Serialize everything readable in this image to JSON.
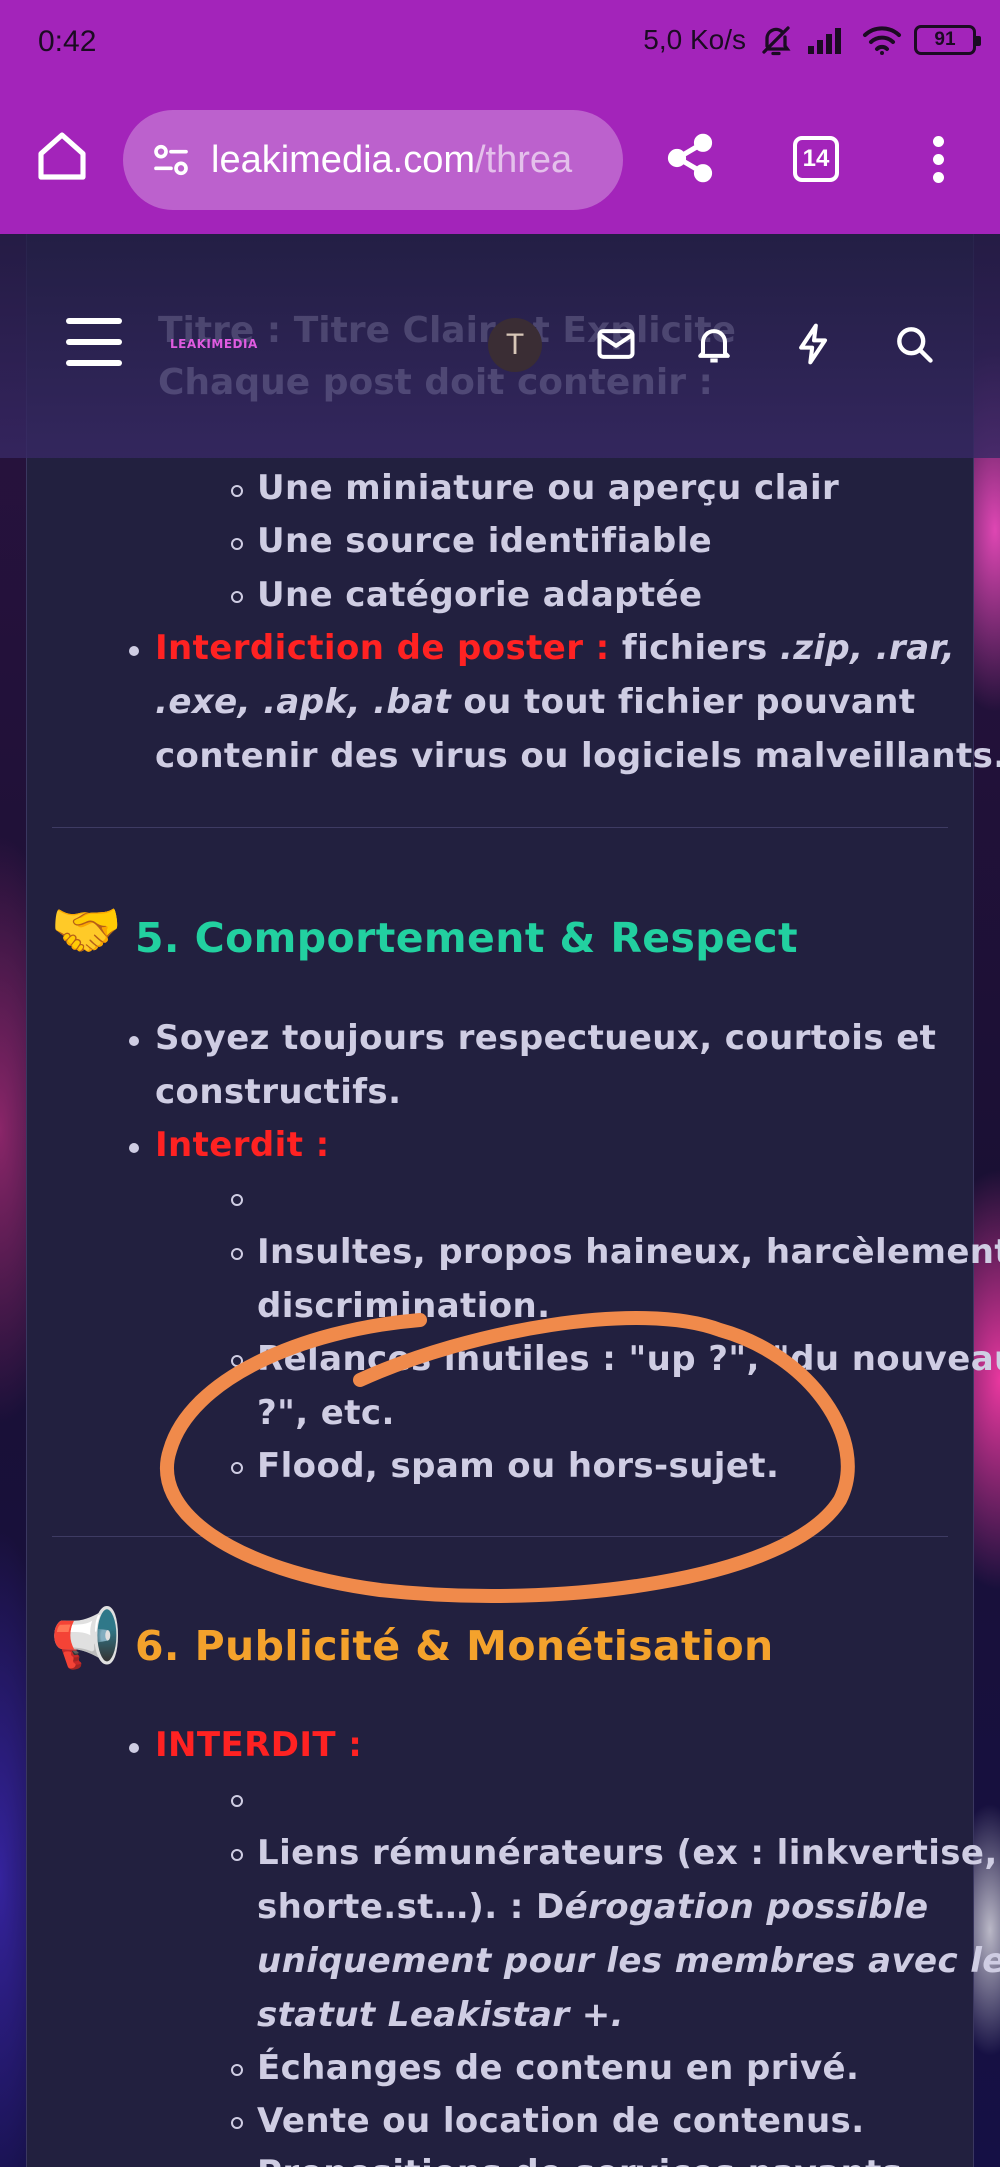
{
  "status_bar": {
    "time": "0:42",
    "speed": "5,0 Ko/s",
    "battery": "91"
  },
  "browser": {
    "url_domain": "leakimedia.com",
    "url_path": "/threa",
    "tab_count": "14"
  },
  "site_header": {
    "logo_text": "LEAKIMEDIA",
    "avatar_letter": "T",
    "ghost_line_1": "Titre : Titre Clair et Explicite",
    "ghost_line_2": "Chaque post doit contenir :"
  },
  "article": {
    "list_a": {
      "sub_items": [
        "Une miniature ou aperçu clair",
        "Une source identifiable",
        "Une catégorie adaptée"
      ],
      "forbidden_label": "Interdiction de poster :",
      "forbidden_l1_a": " fichiers ",
      "forbidden_l1_b": ".zip, .rar,",
      "forbidden_l2_a": ".exe, .apk, .bat",
      "forbidden_l2_b": " ou tout fichier pouvant",
      "forbidden_l3": "contenir des virus ou logiciels malveillants."
    },
    "section5": {
      "emoji": "🤝",
      "title": "5. Comportement & Respect",
      "bullet1_l1": "Soyez toujours respectueux, courtois et",
      "bullet1_l2": "constructifs.",
      "forbidden_label": "Interdit :",
      "sub_items": [
        "",
        "Insultes, propos haineux, harcèlement,",
        "discrimination.",
        "Relances inutiles : \"up ?\", \"du nouveau",
        "?\", etc.",
        "Flood, spam ou hors-sujet."
      ]
    },
    "section6": {
      "emoji": "📢",
      "title": "6. Publicité & Monétisation",
      "forbidden_label": "INTERDIT :",
      "links_l1": "Liens rémunérateurs (ex : linkvertise,",
      "links_l2_a": "shorte.st…). : D",
      "links_l2_b": "érogation possible",
      "links_l3": "uniquement pour les membres avec le",
      "links_l4": "statut Leakistar +.",
      "item_exchange": "Échanges de contenu en privé.",
      "item_sale": "Vente ou location de contenus.",
      "item_partial": "Propositions de services payants"
    }
  },
  "colors": {
    "browser_bar": "#a324ba",
    "red_label": "#ff2222",
    "heading_green": "#22d0a0",
    "heading_orange": "#f4a22c",
    "annotation": "#f08a4b"
  }
}
